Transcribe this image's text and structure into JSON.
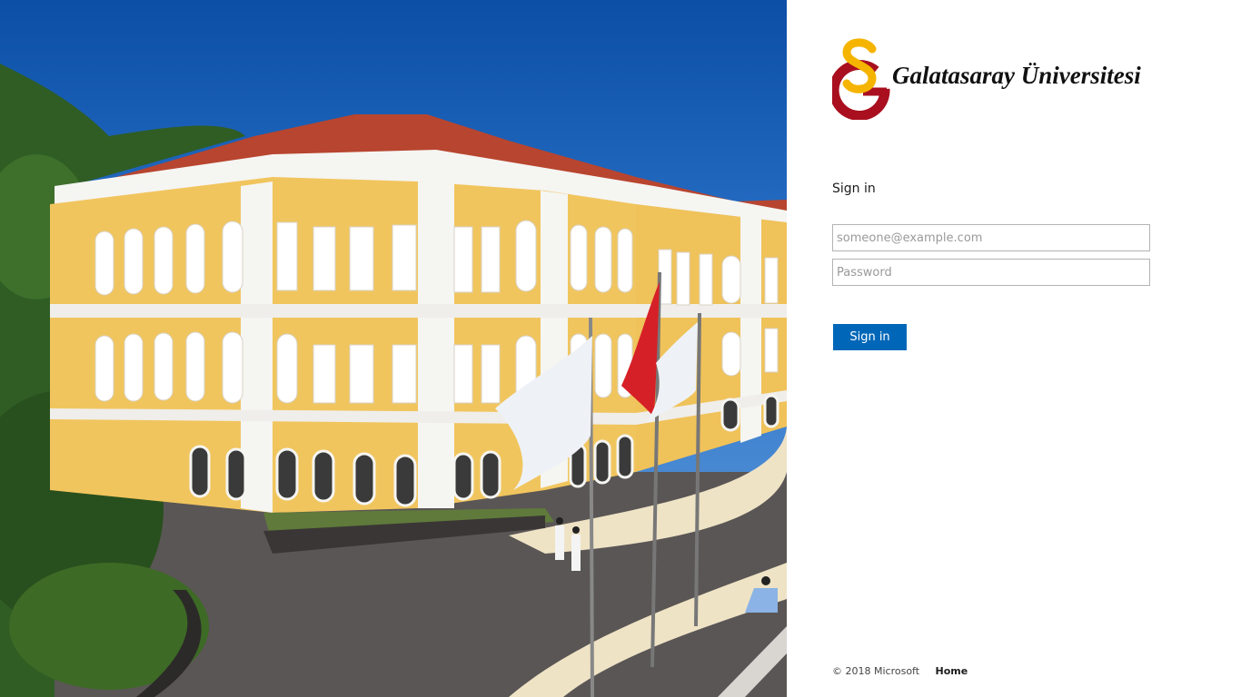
{
  "illustration": {
    "colors": {
      "sky": "#0b4fa6",
      "building": "#f1c55e",
      "trim": "#f5f5f2",
      "roof": "#b8452f",
      "ground": "#5a5655",
      "path": "#efe3c6",
      "trees": "#2f5d24"
    }
  },
  "branding": {
    "logo_icon": "gs-monogram-icon",
    "logo_text": "Galatasaray Üniversitesi",
    "colors": {
      "red": "#a90f1f",
      "yellow": "#f5b400"
    }
  },
  "signin": {
    "title": "Sign in",
    "username_placeholder": "someone@example.com",
    "password_placeholder": "Password",
    "button_label": "Sign in",
    "button_color": "#0067b8"
  },
  "footer": {
    "copyright": "© 2018 Microsoft",
    "home_link": "Home"
  }
}
